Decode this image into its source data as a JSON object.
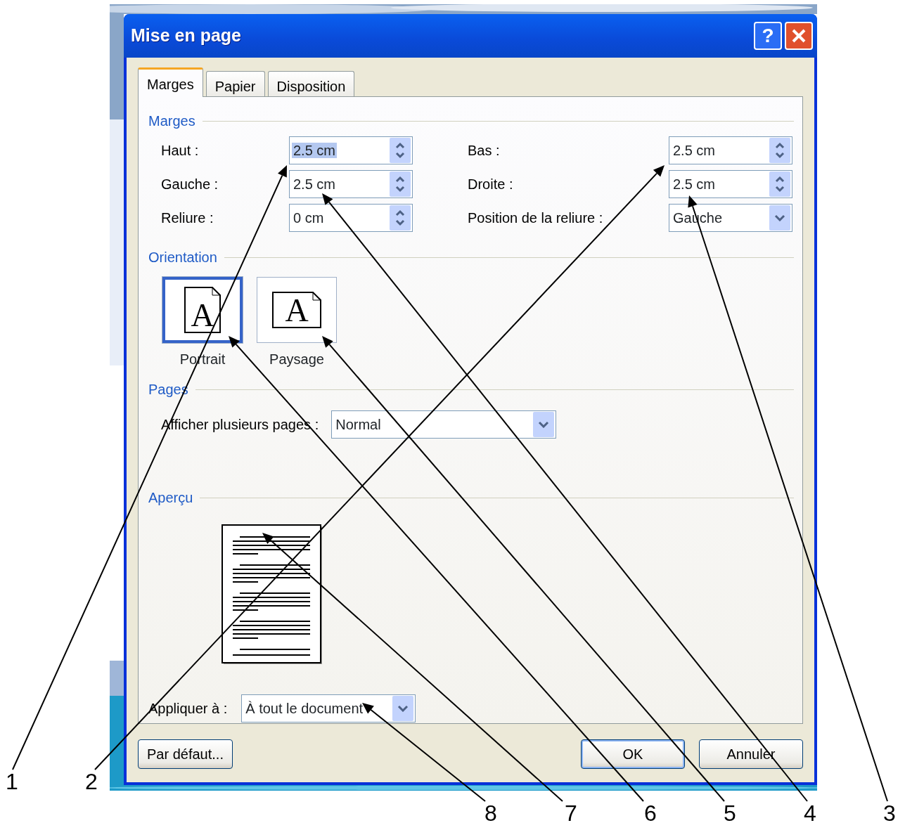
{
  "window": {
    "title": "Mise en page",
    "help_button": "?"
  },
  "tabs": [
    {
      "label": "Marges",
      "selected": true
    },
    {
      "label": "Papier",
      "selected": false
    },
    {
      "label": "Disposition",
      "selected": false
    }
  ],
  "margins": {
    "heading": "Marges",
    "fields": [
      {
        "label": "Haut :",
        "value": "2.5 cm",
        "kind": "spin",
        "text_selected": true
      },
      {
        "label": "Bas :",
        "value": "2.5 cm",
        "kind": "spin",
        "text_selected": false
      },
      {
        "label": "Gauche :",
        "value": "2.5 cm",
        "kind": "spin",
        "text_selected": false
      },
      {
        "label": "Droite :",
        "value": "2.5 cm",
        "kind": "spin",
        "text_selected": false
      },
      {
        "label": "Reliure :",
        "value": "0 cm",
        "kind": "spin",
        "text_selected": false
      },
      {
        "label": "Position de la reliure :",
        "value": "Gauche",
        "kind": "dropdown",
        "text_selected": false
      }
    ]
  },
  "orientation": {
    "heading": "Orientation",
    "options": [
      {
        "label": "Portrait",
        "icon_letter": "A",
        "kind": "portrait",
        "selected": true
      },
      {
        "label": "Paysage",
        "icon_letter": "A",
        "kind": "landscape",
        "selected": false
      }
    ]
  },
  "pages": {
    "heading": "Pages",
    "label": "Afficher plusieurs pages :",
    "value": "Normal"
  },
  "preview": {
    "heading": "Aperçu",
    "apply_label": "Appliquer à :",
    "apply_value": "À tout le document"
  },
  "buttons": [
    {
      "label": "Par défaut...",
      "default": false
    },
    {
      "label": "OK",
      "default": true
    },
    {
      "label": "Annuler",
      "default": false
    }
  ],
  "callouts": [
    "1",
    "2",
    "8",
    "7",
    "6",
    "5",
    "4",
    "3"
  ]
}
